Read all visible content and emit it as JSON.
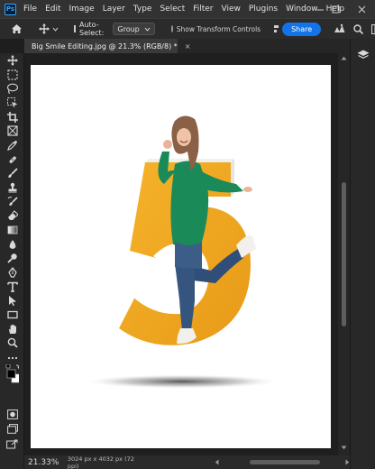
{
  "app": {
    "logo_text": "Ps",
    "menus": [
      "File",
      "Edit",
      "Image",
      "Layer",
      "Type",
      "Select",
      "Filter",
      "View",
      "Plugins",
      "Window",
      "Help"
    ]
  },
  "options_bar": {
    "auto_select_label": "Auto-Select:",
    "auto_select_checked": true,
    "auto_select_target": "Group",
    "transform_controls_label": "Show Transform Controls",
    "transform_controls_checked": false,
    "share_label": "Share"
  },
  "document": {
    "tab_title": "Big Smile Editing.jpg @ 21.3% (RGB/8) *",
    "tab_close": "×"
  },
  "status": {
    "zoom": "21.33%",
    "doc_info": "3024 px x 4032 px (72 ppi)"
  },
  "toolbar": {
    "tools": [
      "move-tool",
      "artboard-tool",
      "lasso-tool",
      "object-selection-tool",
      "crop-tool",
      "frame-tool",
      "eyedropper-tool",
      "spot-healing-brush-tool",
      "brush-tool",
      "clone-stamp-tool",
      "history-brush-tool",
      "eraser-tool",
      "gradient-tool",
      "blur-tool",
      "dodge-tool",
      "pen-tool",
      "type-tool",
      "path-selection-tool",
      "rectangle-tool",
      "hand-tool",
      "zoom-tool",
      "more-tools",
      "swap-colors",
      "foreground-background-colors",
      "quick-mask-mode",
      "screen-mode",
      "share-for-review"
    ]
  },
  "colors": {
    "foreground": "#000000",
    "background": "#ffffff",
    "accent": "#1473e6",
    "figure_fill": "#f1ab22",
    "jacket": "#1a8a58"
  }
}
